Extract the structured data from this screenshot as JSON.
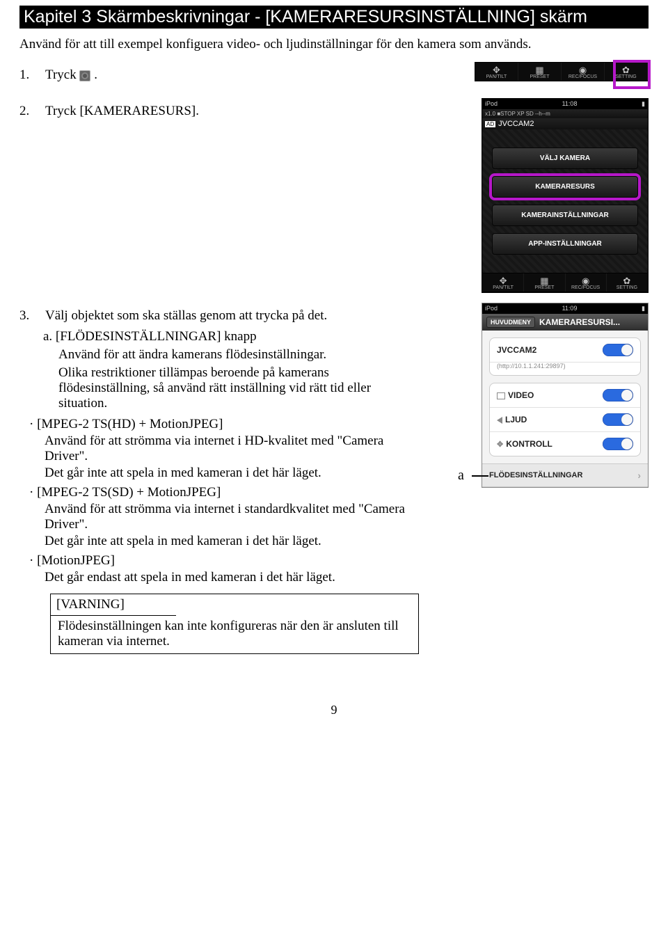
{
  "chapter": "Kapitel 3   Skärmbeskrivningar - [KAMERARESURSINSTÄLLNING] skärm",
  "intro": "Använd för att till exempel konfiguera video- och ljudinställningar för den kamera som används.",
  "step1": {
    "num": "1.",
    "text": "Tryck",
    "suffix": "."
  },
  "step2": {
    "num": "2.",
    "text": "Tryck [KAMERARESURS]."
  },
  "step3": {
    "num": "3.",
    "text": "Välj objektet som ska ställas genom att trycka på det.",
    "a_label": "a.  [FLÖDESINSTÄLLNINGAR] knapp",
    "a_p1": "Använd för att ändra kamerans flödesinställningar.",
    "a_p2": "Olika restriktioner tillämpas beroende på kamerans flödesinställning, så använd rätt inställning vid rätt tid eller situation."
  },
  "modes": {
    "m1_head": "·  [MPEG-2 TS(HD) + MotionJPEG]",
    "m1_p1": "Använd för att strömma via internet i HD-kvalitet med \"Camera Driver\".",
    "m1_p2": "Det går inte att spela in med kameran i det här läget.",
    "m2_head": "·  [MPEG-2 TS(SD) + MotionJPEG]",
    "m2_p1": "Använd för att strömma via internet   i    standardkvalitet med \"Camera Driver\".",
    "m2_p2": "Det går inte att spela in med kameran i det här läget.",
    "m3_head": "·  [MotionJPEG]",
    "m3_p1": "Det går endast att spela in med kameran i det här läget."
  },
  "warning": {
    "title": "[VARNING]",
    "body": "Flödesinställningen kan inte konfigureras när den är ansluten till kameran via internet."
  },
  "toolbar": {
    "pantilt": "PAN/TILT",
    "preset": "PRESET",
    "recfocus": "REC/FOCUS",
    "setting": "SETTING"
  },
  "phone": {
    "carrier": "iPod",
    "time": "11:08",
    "info1": "x1.0           ■STOP XP SD  --h--m",
    "brand": "JVCCAM2",
    "btn1": "VÄLJ KAMERA",
    "btn2": "KAMERARESURS",
    "btn3": "KAMERAINSTÄLLNINGAR",
    "btn4": "APP-INSTÄLLNINGAR"
  },
  "phone2": {
    "carrier": "iPod",
    "time": "11:09",
    "back": "HUVUDMENY",
    "title": "KAMERARESURSI...",
    "cam": "JVCCAM2",
    "url": "(http://10.1.1.241:29897)",
    "video": "VIDEO",
    "ljud": "LJUD",
    "kontroll": "KONTROLL",
    "flow": "FLÖDESINSTÄLLNINGAR",
    "pointer": "a"
  },
  "pagenum": "9"
}
